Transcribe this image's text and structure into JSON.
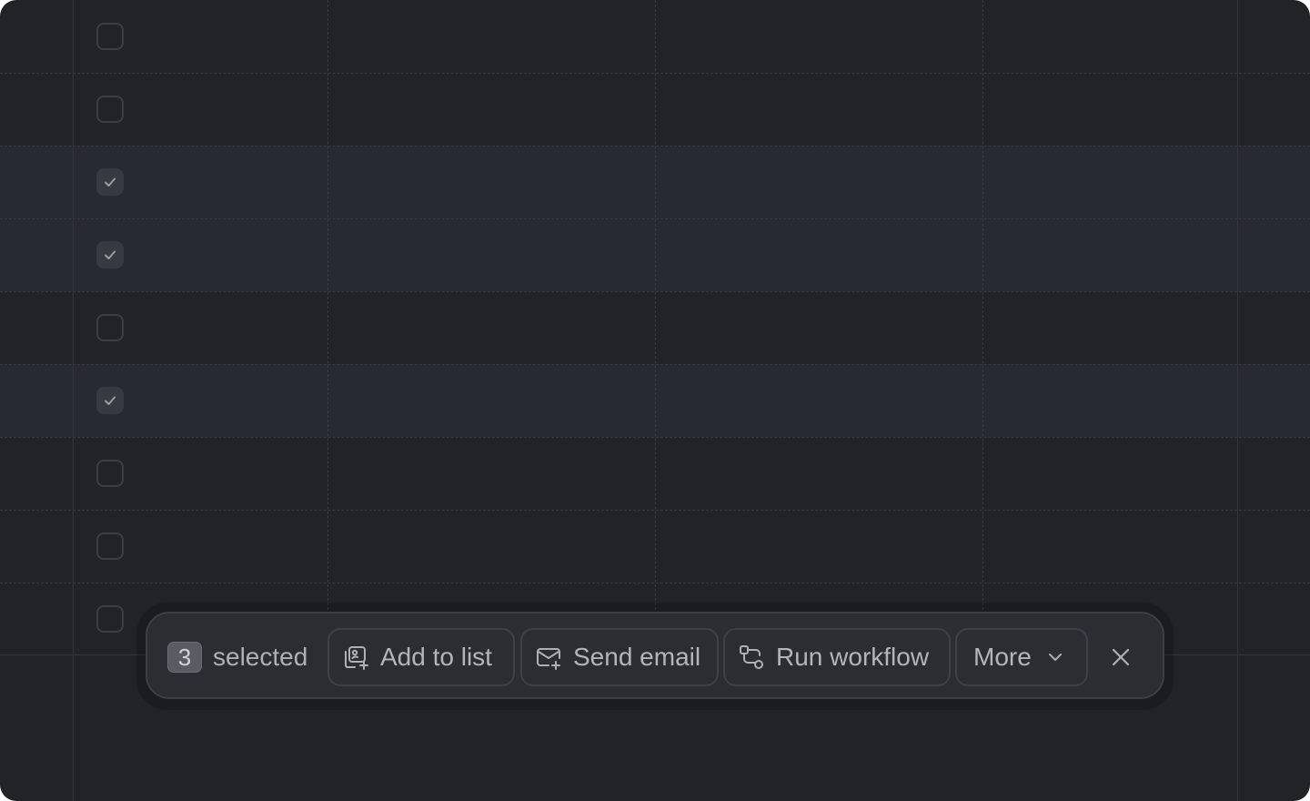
{
  "table": {
    "rows": [
      {
        "checked": false
      },
      {
        "checked": false
      },
      {
        "checked": true
      },
      {
        "checked": true
      },
      {
        "checked": false
      },
      {
        "checked": true
      },
      {
        "checked": false
      },
      {
        "checked": false
      },
      {
        "checked": false
      }
    ]
  },
  "bulk_toolbar": {
    "selected_count": "3",
    "selected_label": "selected",
    "add_to_list": {
      "label": "Add to list",
      "icon": "add-to-list-icon"
    },
    "send_email": {
      "label": "Send email",
      "icon": "mail-plus-icon"
    },
    "run_workflow": {
      "label": "Run workflow",
      "icon": "workflow-icon"
    },
    "more": {
      "label": "More",
      "icon": "chevron-down-icon"
    },
    "close": {
      "icon": "close-icon"
    }
  },
  "colors": {
    "background": "#222327",
    "selected_row": "#272a33",
    "toolbar": "#2b2d33",
    "text": "#b3b5bb"
  }
}
